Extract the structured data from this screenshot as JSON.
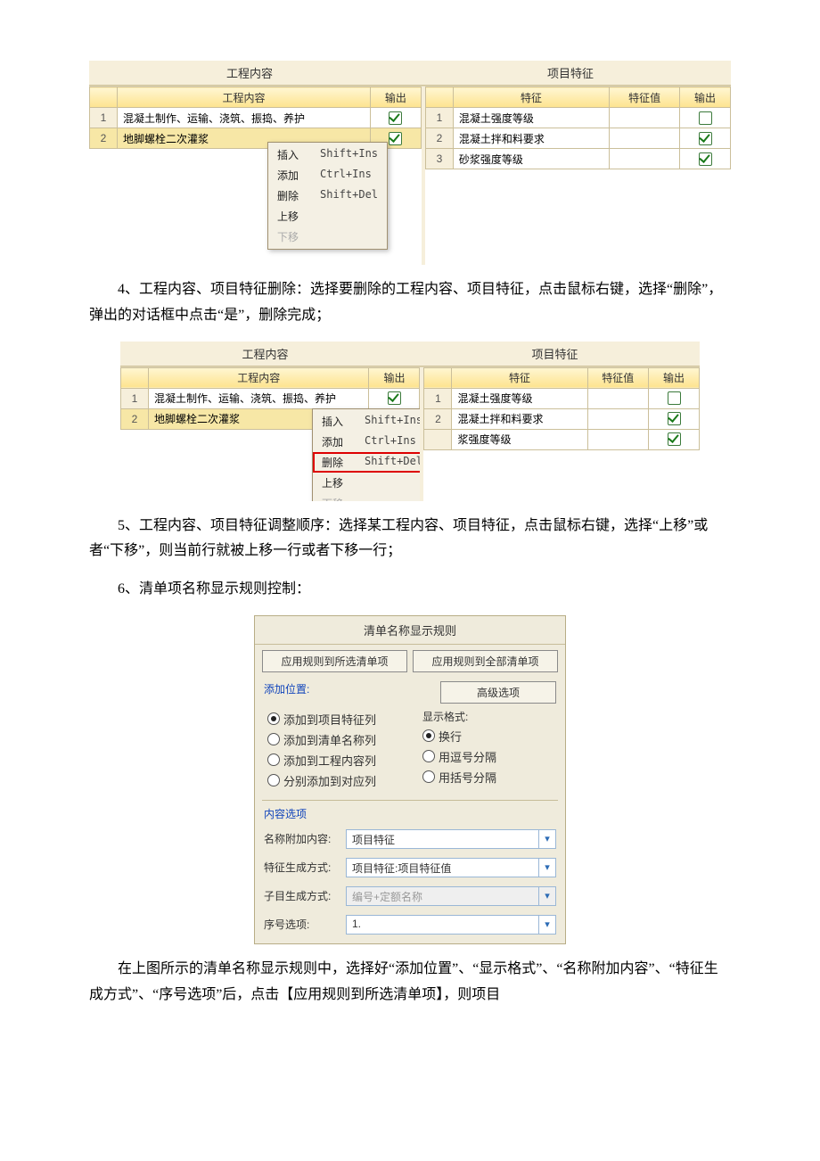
{
  "tabs": {
    "left": "工程内容",
    "right": "项目特征"
  },
  "leftGrid": {
    "cols": {
      "num": "",
      "content": "工程内容",
      "out": "输出"
    },
    "rows": [
      {
        "num": "1",
        "content": "混凝土制作、运输、浇筑、振捣、养护",
        "checked": true
      },
      {
        "num": "2",
        "content": "地脚螺栓二次灌浆",
        "checked": true
      }
    ]
  },
  "rightGrid": {
    "cols": {
      "num": "",
      "feat": "特征",
      "val": "特征值",
      "out": "输出"
    },
    "rows": [
      {
        "num": "1",
        "feat": "混凝土强度等级",
        "val": "",
        "checked": false
      },
      {
        "num": "2",
        "feat": "混凝土拌和料要求",
        "val": "",
        "checked": true
      },
      {
        "num": "3",
        "feat": "砂浆强度等级",
        "val": "",
        "checked": true
      }
    ]
  },
  "ctxMenu": [
    {
      "label": "插入",
      "shortcut": "Shift+Ins",
      "disabled": false
    },
    {
      "label": "添加",
      "shortcut": "Ctrl+Ins",
      "disabled": false
    },
    {
      "label": "删除",
      "shortcut": "Shift+Del",
      "disabled": false
    },
    {
      "label": "上移",
      "shortcut": "",
      "disabled": false
    },
    {
      "label": "下移",
      "shortcut": "",
      "disabled": true
    }
  ],
  "para4": "4、工程内容、项目特征删除：选择要删除的工程内容、项目特征，点击鼠标右键，选择“删除”，弹出的对话框中点击“是”，删除完成；",
  "para5": "5、工程内容、项目特征调整顺序：选择某工程内容、项目特征，点击鼠标右键，选择“上移”或者“下移”，则当前行就被上移一行或者下移一行；",
  "para6": "6、清单项名称显示规则控制：",
  "para7": "在上图所示的清单名称显示规则中，选择好“添加位置”、“显示格式”、“名称附加内容”、“特征生成方式”、“序号选项”后，点击【应用规则到所选清单项】，则项目",
  "shot2": {
    "rightRows": [
      {
        "num": "1",
        "feat": "混凝土强度等级",
        "checked": false
      },
      {
        "num": "2",
        "feat": "混凝土拌和料要求",
        "checked": true
      },
      {
        "num": "",
        "feat": "浆强度等级",
        "checked": true
      }
    ],
    "hlIndex": 2
  },
  "dialog": {
    "title": "清单名称显示规则",
    "btnApplySel": "应用规则到所选清单项",
    "btnApplyAll": "应用规则到全部清单项",
    "addPosLabel": "添加位置:",
    "advanced": "高级选项",
    "addPos": [
      "添加到项目特征列",
      "添加到清单名称列",
      "添加到工程内容列",
      "分别添加到对应列"
    ],
    "formatLabel": "显示格式:",
    "format": [
      "换行",
      "用逗号分隔",
      "用括号分隔"
    ],
    "contentOpt": "内容选项",
    "nameAppendLabel": "名称附加内容:",
    "nameAppendVal": "项目特征",
    "featGenLabel": "特征生成方式:",
    "featGenVal": "项目特征:项目特征值",
    "subGenLabel": "子目生成方式:",
    "subGenVal": "编号+定额名称",
    "seqLabel": "序号选项:",
    "seqVal": "1."
  }
}
